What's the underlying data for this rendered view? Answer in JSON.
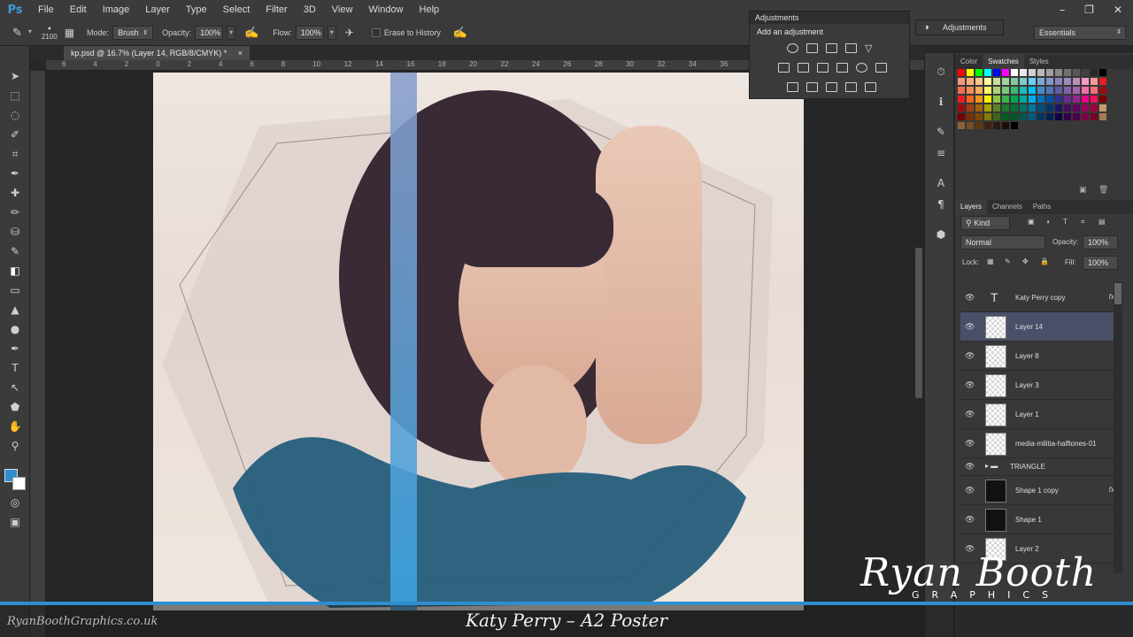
{
  "app": {
    "logo": "Ps"
  },
  "menu": [
    "File",
    "Edit",
    "Image",
    "Layer",
    "Type",
    "Select",
    "Filter",
    "3D",
    "View",
    "Window",
    "Help"
  ],
  "window_controls": [
    "–",
    "❐",
    "✕"
  ],
  "options_bar": {
    "brush_size": "2100",
    "mode_label": "Mode:",
    "mode_value": "Brush",
    "opacity_label": "Opacity:",
    "opacity_value": "100%",
    "flow_label": "Flow:",
    "flow_value": "100%",
    "erase_history_label": "Erase to History"
  },
  "workspace": "Essentials",
  "document_tab": {
    "title": "kp.psd @ 16.7% (Layer 14, RGB/8/CMYK) *",
    "close": "×"
  },
  "ruler_labels": [
    "6",
    "4",
    "2",
    "0",
    "2",
    "4",
    "6",
    "8",
    "10",
    "12",
    "14",
    "16",
    "18",
    "20",
    "22",
    "24",
    "26",
    "28",
    "30",
    "32",
    "34",
    "36"
  ],
  "adjustments_panel": {
    "title": "Adjustments",
    "subtitle": "Add an adjustment"
  },
  "adjustments_collapsed": "Adjustments",
  "color_panel_tabs": [
    "Color",
    "Swatches",
    "Styles"
  ],
  "layers_panel": {
    "tabs": [
      "Layers",
      "Channels",
      "Paths"
    ],
    "filter_kind": "Kind",
    "blend_mode": "Normal",
    "opacity_label": "Opacity:",
    "opacity_value": "100%",
    "lock_label": "Lock:",
    "fill_label": "Fill:",
    "fill_value": "100%",
    "layers": [
      {
        "name": "Katy Perry copy",
        "fx": "fx",
        "type": "text"
      },
      {
        "name": "Layer 14",
        "fx": "",
        "type": "selected"
      },
      {
        "name": "Layer 8",
        "fx": "",
        "type": "pixel"
      },
      {
        "name": "Layer 3",
        "fx": "",
        "type": "pixel"
      },
      {
        "name": "Layer 1",
        "fx": "",
        "type": "pixel"
      },
      {
        "name": "media-militia-halftones-01",
        "fx": "",
        "type": "pixel"
      },
      {
        "name": "TRIANGLE",
        "fx": "",
        "type": "group"
      },
      {
        "name": "Shape 1 copy",
        "fx": "fx",
        "type": "shape"
      },
      {
        "name": "Shape 1",
        "fx": "",
        "type": "shape"
      },
      {
        "name": "Layer 2",
        "fx": "",
        "type": "pixel"
      }
    ]
  },
  "watermark": {
    "brand": "Ryan Booth",
    "brand_sub": "GRAPHICS",
    "site": "RyanBoothGraphics.co.uk"
  },
  "caption": "Katy Perry – A2 Poster",
  "colors": {
    "accent": "#2e8ecf",
    "selection": "#4a4f69",
    "panel": "#383838"
  }
}
